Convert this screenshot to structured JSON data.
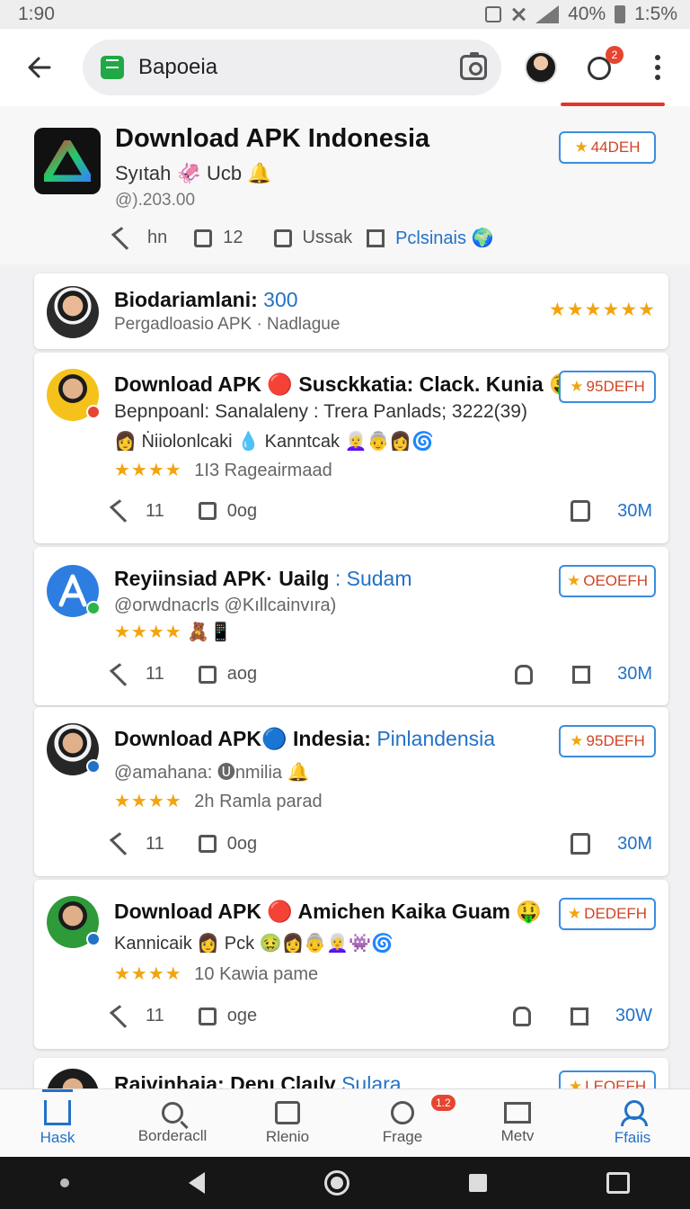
{
  "status_bar": {
    "time": "1:90",
    "battery": "40%",
    "clock_right": "1:5%"
  },
  "header": {
    "url_text": "Bapoeia",
    "notification_count": "2"
  },
  "app": {
    "title": "Download APK Indonesia",
    "subtitle": "Syıtah 🦑 Ucb 🔔",
    "version": "@).203.00",
    "rating_pill": "44DEH",
    "actions": [
      {
        "label": "hn"
      },
      {
        "label": "12"
      },
      {
        "label": "Ussak"
      },
      {
        "label": "Pclsinais 🌍"
      }
    ]
  },
  "summary": {
    "name": "Biodariamlani:",
    "count": "300",
    "description": "Pergadloasio APK · Nadlague",
    "stars": "★★★★★★"
  },
  "posts": [
    {
      "name": "Download APK 🔴 Susckkatia: Clack. Kunia 🤑",
      "line2": "Bepnpoanl: Sanalaleny : Trera Panlads; 3222(39)",
      "line3": "👩 Ṅiiolonlcaki  💧 Kanntcak 👩‍🦳👵👩🌀",
      "stars": "★★★★",
      "meta": "1I3 Rageairmaad",
      "pill": "95DEFH",
      "reply": "11",
      "share": "0og",
      "count": "30M"
    },
    {
      "name": "Reyiinsiad APK· Uailg",
      "name_link": ": Sudam",
      "line2": "@orwdnacrls  @Kıllcainvıra)",
      "line3": "",
      "stars": "★★★★",
      "meta": "🧸📱",
      "pill": "OEOEFH",
      "reply": "11",
      "share": "aog",
      "count": "30M"
    },
    {
      "name": "Download APK🔵 Indesia:",
      "name_link": "Pinlandensia",
      "line2": "@amahana:  🅤nmilia 🔔",
      "stars": "★★★★",
      "meta": "2h Ramla parad",
      "pill": "95DEFH",
      "reply": "11",
      "share": "0og",
      "count": "30M"
    },
    {
      "name": "Download APK 🔴 Amichen Kaika Guam 🤑",
      "line2": "Kannicaik  👩 Pck 🤢👩👵👩‍🦳👾🌀",
      "stars": "★★★★",
      "meta": "10 Kawia pame",
      "pill": "DEDEFH",
      "reply": "11",
      "share": "oge",
      "count": "30W"
    },
    {
      "name": "Raivinhaia: Denı Claılv",
      "name_link": "Sulara",
      "pill": "LEOEFH"
    }
  ],
  "bottom_nav": [
    {
      "label": "Hask"
    },
    {
      "label": "Borderacll"
    },
    {
      "label": "Rlenio"
    },
    {
      "label": "Frage",
      "badge": "1.2"
    },
    {
      "label": "Metv"
    },
    {
      "label": "Ffaiis"
    }
  ],
  "colors": {
    "accent": "#2272c8",
    "star": "#f2a40f",
    "badge": "#e64530"
  }
}
